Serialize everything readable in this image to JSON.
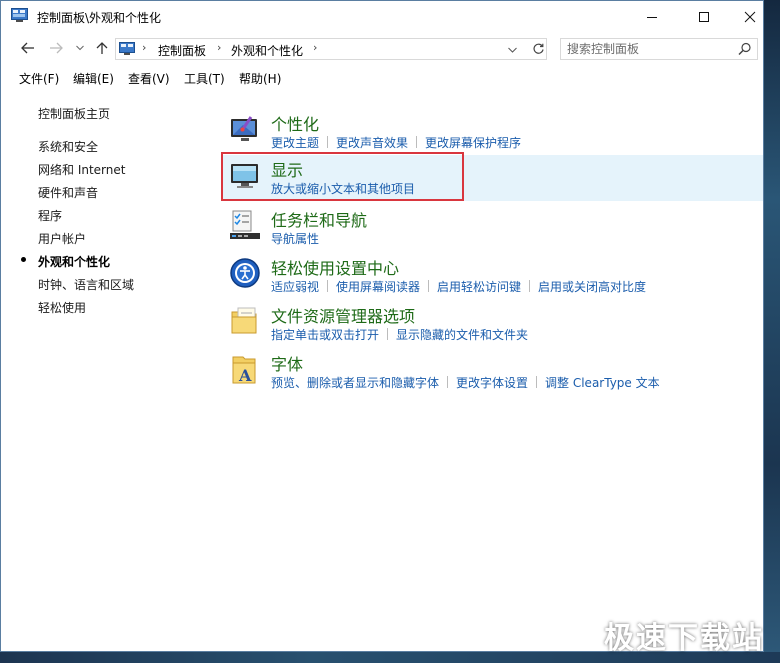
{
  "window": {
    "title": "控制面板\\外观和个性化",
    "controls": {
      "minimize": "—",
      "maximize": "☐",
      "close": "✕"
    }
  },
  "nav": {
    "back": "←",
    "forward": "→",
    "recent": "⌄",
    "up": "↑",
    "breadcrumb": [
      "控制面板",
      "外观和个性化"
    ],
    "separator": "›",
    "dropdown": "⌄",
    "refresh": "↻",
    "search_placeholder": "搜索控制面板"
  },
  "menu": [
    "文件(F)",
    "编辑(E)",
    "查看(V)",
    "工具(T)",
    "帮助(H)"
  ],
  "sidebar": {
    "home": "控制面板主页",
    "items": [
      {
        "label": "系统和安全",
        "current": false
      },
      {
        "label": "网络和 Internet",
        "current": false
      },
      {
        "label": "硬件和声音",
        "current": false
      },
      {
        "label": "程序",
        "current": false
      },
      {
        "label": "用户帐户",
        "current": false
      },
      {
        "label": "外观和个性化",
        "current": true
      },
      {
        "label": "时钟、语言和区域",
        "current": false
      },
      {
        "label": "轻松使用",
        "current": false
      }
    ]
  },
  "categories": [
    {
      "title": "个性化",
      "icon": "personalization-icon",
      "links": [
        "更改主题",
        "更改声音效果",
        "更改屏幕保护程序"
      ]
    },
    {
      "title": "显示",
      "icon": "display-icon",
      "links": [
        "放大或缩小文本和其他项目"
      ],
      "highlighted": true
    },
    {
      "title": "任务栏和导航",
      "icon": "taskbar-icon",
      "links": [
        "导航属性"
      ]
    },
    {
      "title": "轻松使用设置中心",
      "icon": "ease-of-access-icon",
      "links": [
        "适应弱视",
        "使用屏幕阅读器",
        "启用轻松访问键",
        "启用或关闭高对比度"
      ]
    },
    {
      "title": "文件资源管理器选项",
      "icon": "folder-options-icon",
      "links": [
        "指定单击或双击打开",
        "显示隐藏的文件和文件夹"
      ]
    },
    {
      "title": "字体",
      "icon": "fonts-icon",
      "links": [
        "预览、删除或者显示和隐藏字体",
        "更改字体设置",
        "调整 ClearType 文本"
      ]
    }
  ],
  "colors": {
    "category_title": "#1e6a17",
    "link": "#1b5dac",
    "highlight_bg": "#e5f3fb",
    "annotation_box": "#d9363e"
  },
  "watermark": "极速下载站"
}
